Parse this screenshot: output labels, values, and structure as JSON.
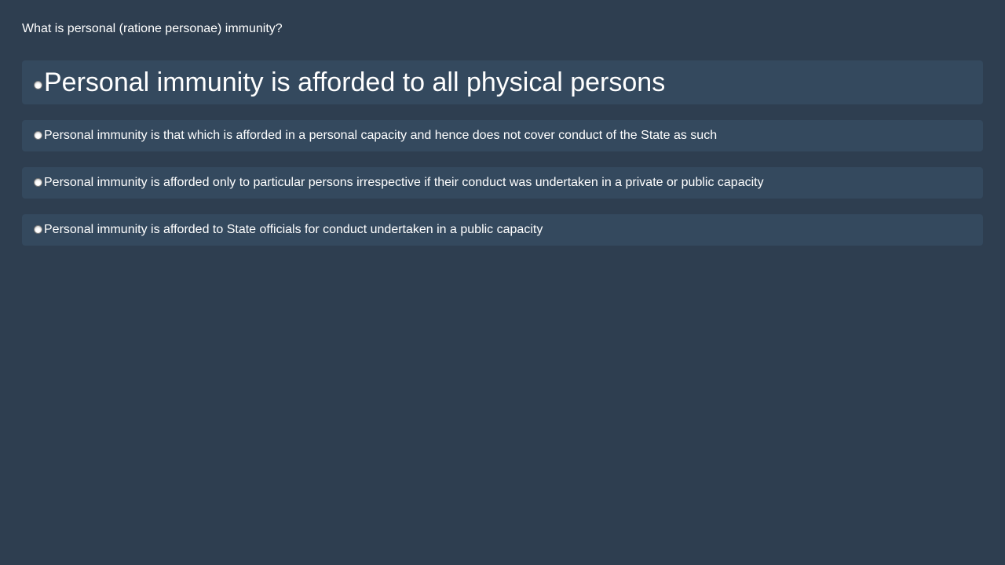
{
  "question": {
    "text": "What is personal (ratione personae) immunity?"
  },
  "options": [
    {
      "label": "Personal immunity is afforded to all physical persons",
      "selected": false
    },
    {
      "label": "Personal immunity is that which is afforded in a personal capacity and hence does not cover conduct of the State as such",
      "selected": false
    },
    {
      "label": "Personal immunity is afforded only to particular persons irrespective if their conduct was undertaken in a private or public capacity",
      "selected": false
    },
    {
      "label": "Personal immunity is afforded to State officials for conduct undertaken in a public capacity",
      "selected": false
    }
  ],
  "colors": {
    "background": "#2e3e50",
    "option_background": "#34495e",
    "text": "#ffffff"
  },
  "icons": {
    "option_marker": "radio-button-unchecked-icon"
  }
}
